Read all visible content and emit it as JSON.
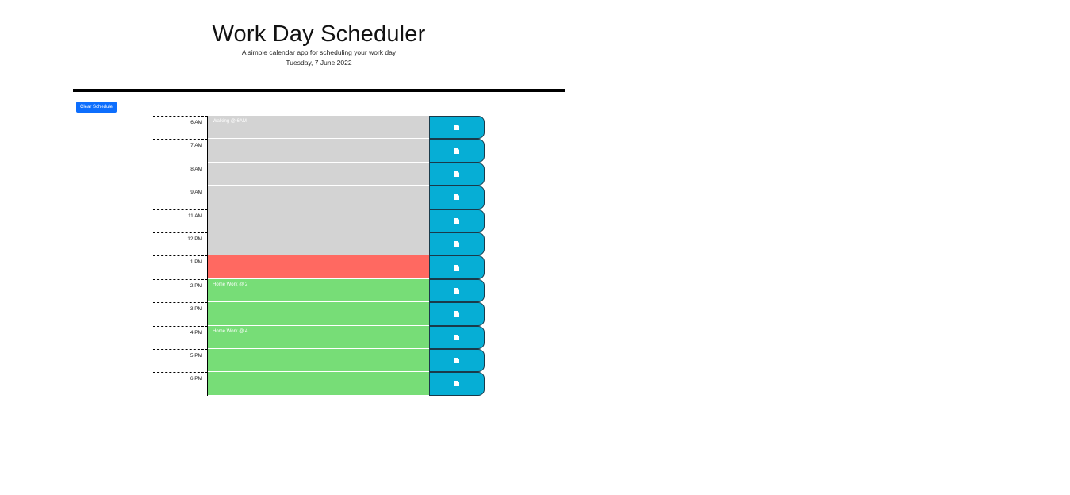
{
  "header": {
    "title": "Work Day Scheduler",
    "subtitle": "A simple calendar app for scheduling your work day",
    "current_day": "Tuesday, 7 June 2022"
  },
  "controls": {
    "clear_label": "Clear Schedule"
  },
  "colors": {
    "past": "#d3d3d3",
    "present": "#ff6961",
    "future": "#77dd77",
    "save": "#06aed5",
    "clear_button": "#0d6efd"
  },
  "save_icon": "save-file-icon",
  "blocks": [
    {
      "hour": "6 AM",
      "text": "Walking @ 6AM",
      "state": "past"
    },
    {
      "hour": "7 AM",
      "text": "",
      "state": "past"
    },
    {
      "hour": "8 AM",
      "text": "",
      "state": "past"
    },
    {
      "hour": "9 AM",
      "text": "",
      "state": "past"
    },
    {
      "hour": "11 AM",
      "text": "",
      "state": "past"
    },
    {
      "hour": "12 PM",
      "text": "",
      "state": "past"
    },
    {
      "hour": "1 PM",
      "text": "",
      "state": "present"
    },
    {
      "hour": "2 PM",
      "text": "Home Work @ 2",
      "state": "future"
    },
    {
      "hour": "3 PM",
      "text": "",
      "state": "future"
    },
    {
      "hour": "4 PM",
      "text": "Home Work @ 4",
      "state": "future"
    },
    {
      "hour": "5 PM",
      "text": "",
      "state": "future"
    },
    {
      "hour": "6 PM",
      "text": "",
      "state": "future"
    }
  ]
}
